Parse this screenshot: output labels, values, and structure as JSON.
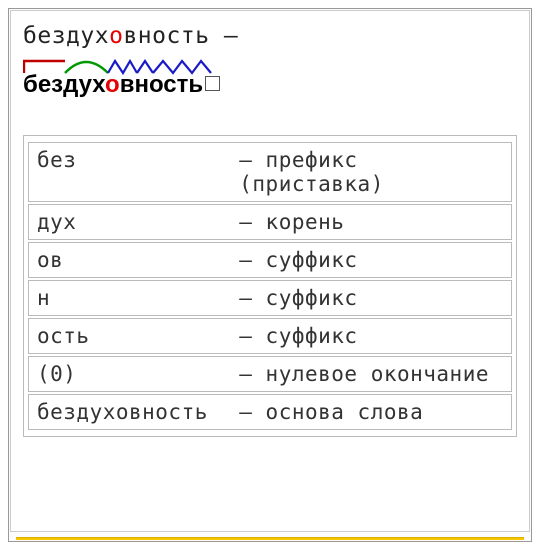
{
  "headline": {
    "pre": "бездух",
    "hl": "о",
    "post": "вность",
    "dash": " —"
  },
  "word": {
    "pre": "бездух",
    "hl": "о",
    "post": "вность"
  },
  "marks": {
    "prefix_color": "#c00000",
    "root_color": "#009900",
    "suffix1_color": "#1a1ac8",
    "suffix2_color": "#1a1ac8",
    "suffix3_color": "#1a1ac8"
  },
  "rows": [
    {
      "morph": "без",
      "desc": "— префикс (приставка)"
    },
    {
      "morph": "дух",
      "desc": "— корень"
    },
    {
      "morph": "ов",
      "desc": "— суффикс"
    },
    {
      "morph": "н",
      "desc": "— суффикс"
    },
    {
      "morph": "ость",
      "desc": "— суффикс"
    },
    {
      "morph": "(0)",
      "desc": "— нулевое окончание"
    },
    {
      "morph": "бездуховность",
      "desc": "— основа слова"
    }
  ]
}
